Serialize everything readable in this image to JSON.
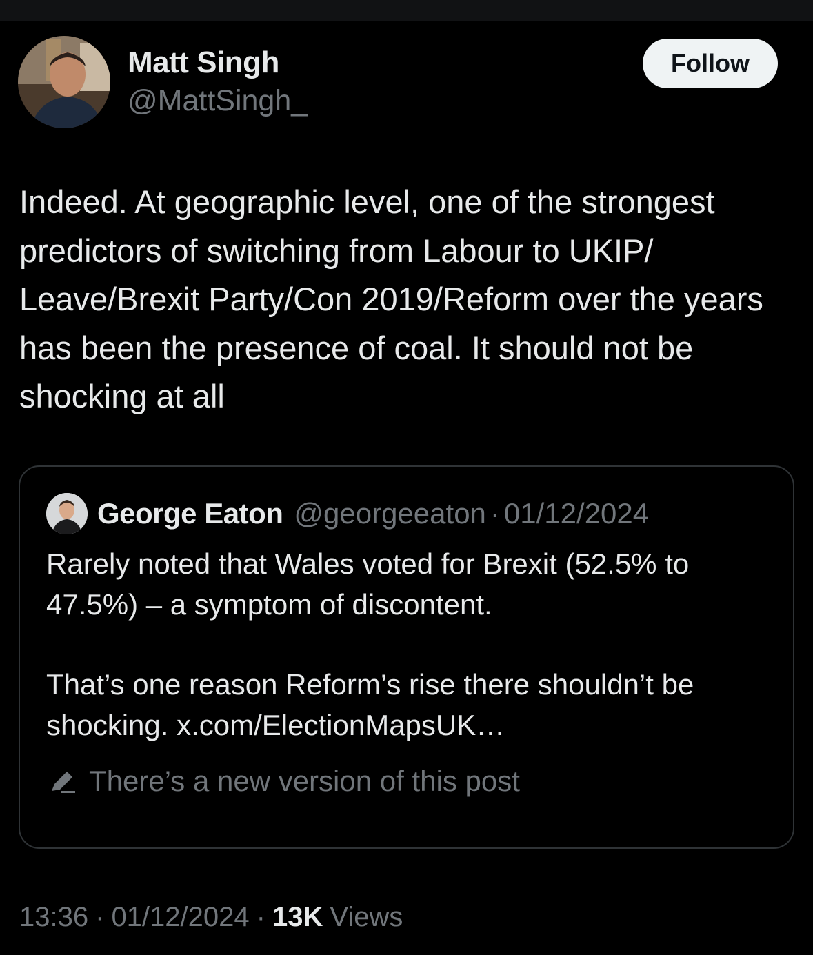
{
  "author": {
    "name": "Matt Singh",
    "handle": "@MattSingh_",
    "avatar_icon": "user-avatar-photo"
  },
  "follow_button": {
    "label": "Follow"
  },
  "post": {
    "text": "Indeed. At geographic level, one of the strongest predictors of switching from Labour to UKIP/\nLeave/Brexit Party/Con 2019/Reform over the years has been the presence of coal. It should not be shocking at all"
  },
  "quoted_post": {
    "author_name": "George Eaton",
    "author_handle": "@georgeeaton",
    "separator": "·",
    "date": "01/12/2024",
    "paragraphs": [
      "Rarely noted that Wales voted for Brexit (52.5% to 47.5%) – a symptom of discontent.",
      "That’s one reason Reform’s rise there shouldn’t be shocking. x.com/ElectionMapsUK…"
    ],
    "edit_notice": "There’s a new version of this post",
    "edit_icon": "pencil-icon"
  },
  "footer": {
    "time": "13:36",
    "separator": "·",
    "date": "01/12/2024",
    "views_count": "13K",
    "views_label": "Views"
  },
  "colors": {
    "background": "#000000",
    "primary_text": "#e7e9ea",
    "secondary_text": "#71767b",
    "border": "#2f3336",
    "button_bg": "#eff3f4"
  }
}
